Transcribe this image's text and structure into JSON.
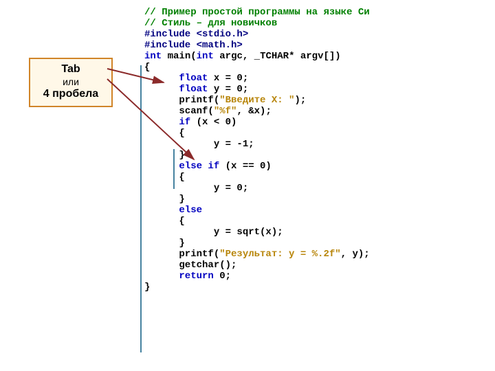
{
  "callout": {
    "l1": "Tab",
    "l2": "или",
    "l3": "4 пробела"
  },
  "code": {
    "c1": "// Пример простой программы на языке Си",
    "c2": "// Стиль – для новичков",
    "inc1_a": "#include ",
    "inc1_b": "<stdio.h>",
    "inc2_a": "#include ",
    "inc2_b": "<math.h>",
    "blank": "",
    "main_a": "int",
    "main_b": " main(",
    "main_c": "int",
    "main_d": " argc, _TCHAR* argv[])",
    "ob": "{",
    "d1_a": "      float",
    "d1_b": " x = 0;",
    "d2_a": "      float",
    "d2_b": " y = 0;",
    "p1_a": "      printf(",
    "p1_b": "\"Введите X: \"",
    "p1_c": ");",
    "s1_a": "      scanf(",
    "s1_b": "\"%f\"",
    "s1_c": ", &x);",
    "if_a": "      if ",
    "if_b": "(x < 0)",
    "ob2": "      {",
    "as1": "            y = -1;",
    "cb2": "      }",
    "elif_a": "      else if ",
    "elif_b": "(x == 0)",
    "ob3": "      {",
    "as2": "            y = 0;",
    "cb3": "      }",
    "else": "      else",
    "ob4": "      {",
    "as3": "            y = sqrt(x);",
    "cb4": "      }",
    "p2_a": "      printf(",
    "p2_b": "\"Результат: y = %.2f\"",
    "p2_c": ", y);",
    "gc": "      getchar();",
    "ret_a": "      return ",
    "ret_b": "0;",
    "cb": "}"
  }
}
